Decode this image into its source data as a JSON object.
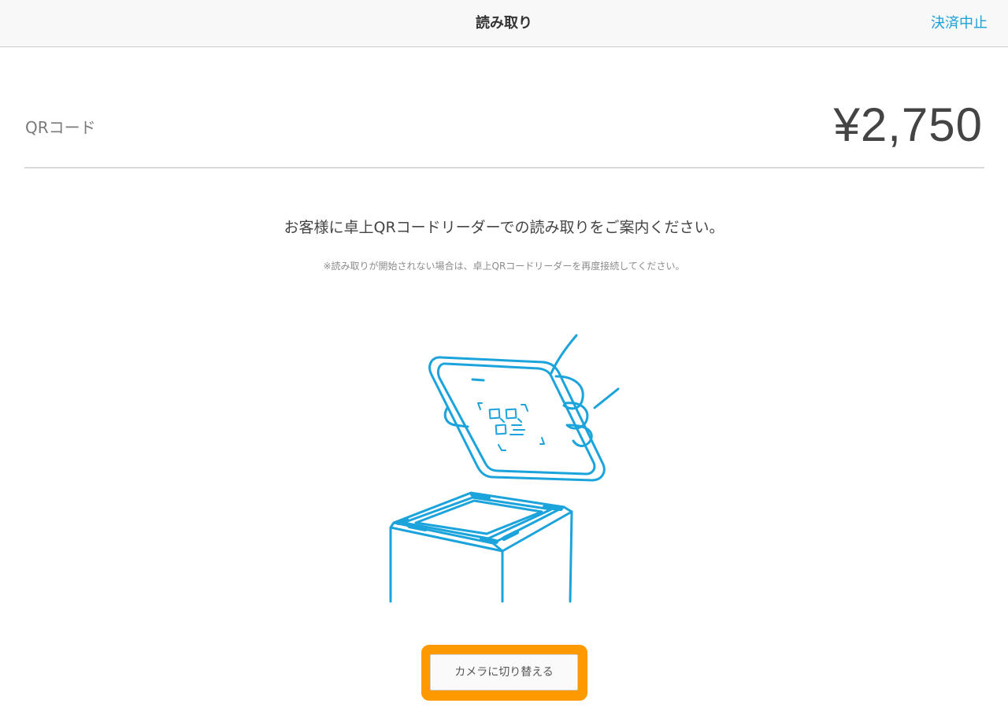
{
  "header": {
    "title": "読み取り",
    "cancel_label": "決済中止"
  },
  "payment": {
    "method_label": "QRコード",
    "amount": "¥2,750"
  },
  "instruction": {
    "main": "お客様に卓上QRコードリーダーでの読み取りをご案内ください。",
    "note": "※読み取りが開始されない場合は、卓上QRコードリーダーを再度接続してください。"
  },
  "actions": {
    "switch_camera_label": "カメラに切り替える"
  },
  "colors": {
    "accent": "#1a9fd9",
    "highlight": "#ff9900"
  }
}
